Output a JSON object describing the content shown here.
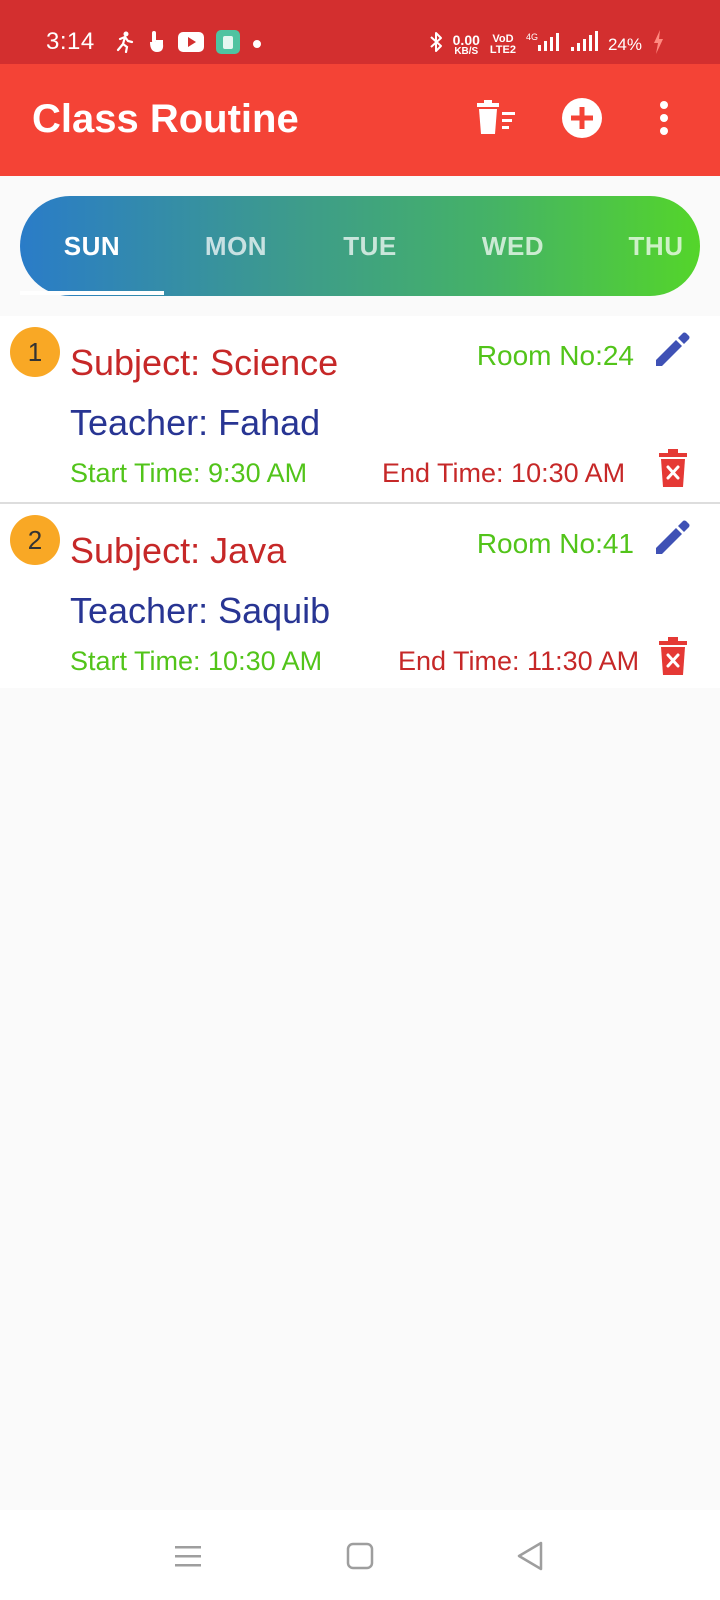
{
  "status_bar": {
    "time": "3:14",
    "net_speed_value": "0.00",
    "net_speed_unit": "KB/S",
    "volte_top": "VoD",
    "volte_bottom": "LTE2",
    "network_type": "4G",
    "battery": "24%",
    "icons": [
      "running-icon",
      "touch-icon",
      "youtube-icon",
      "app-icon",
      "dot-icon",
      "bluetooth-icon",
      "signal-icon",
      "battery-charging-icon"
    ]
  },
  "app_bar": {
    "title": "Class Routine",
    "actions": [
      "delete-all-icon",
      "add-circle-icon",
      "more-vert-icon"
    ]
  },
  "tabs": [
    {
      "label": "SUN",
      "active": true
    },
    {
      "label": "MON",
      "active": false
    },
    {
      "label": "TUE",
      "active": false
    },
    {
      "label": "WED",
      "active": false
    },
    {
      "label": "THU",
      "active": false
    }
  ],
  "routines": [
    {
      "number": "1",
      "subject": "Subject: Science",
      "room": "Room No:24",
      "teacher": "Teacher: Fahad",
      "start": "Start Time: 9:30 AM",
      "end": "End Time: 10:30 AM"
    },
    {
      "number": "2",
      "subject": "Subject: Java",
      "room": "Room No:41",
      "teacher": "Teacher: Saquib",
      "start": "Start Time: 10:30 AM",
      "end": "End Time: 11:30 AM"
    }
  ],
  "colors": {
    "status_bar": "#d32f2f",
    "app_bar": "#f44336",
    "subject": "#c62828",
    "teacher": "#283593",
    "start_time": "#52c41a",
    "badge": "#f9a825",
    "edit_icon": "#3f51b5",
    "delete_icon": "#e53935"
  },
  "nav_bar": {
    "buttons": [
      "menu-icon",
      "home-icon",
      "back-icon"
    ]
  }
}
